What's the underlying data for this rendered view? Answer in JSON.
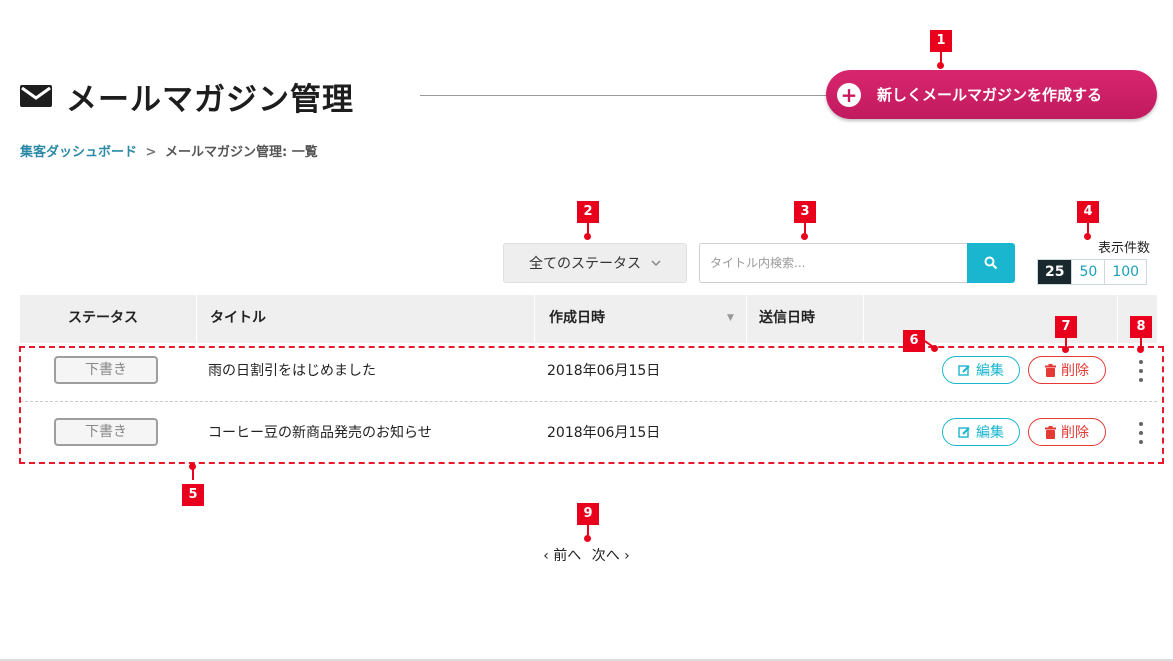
{
  "header": {
    "title": "メールマガジン管理",
    "create_button_label": "新しくメールマガジンを作成する"
  },
  "breadcrumb": {
    "parent": "集客ダッシュボード",
    "separator": ">",
    "current": "メールマガジン管理: 一覧"
  },
  "toolbar": {
    "status_filter": "全てのステータス",
    "search_placeholder": "タイトル内検索...",
    "per_page_label": "表示件数",
    "per_page_options": [
      "25",
      "50",
      "100"
    ],
    "per_page_selected": "25"
  },
  "table": {
    "columns": [
      "ステータス",
      "タイトル",
      "作成日時",
      "送信日時"
    ],
    "rows": [
      {
        "status": "下書き",
        "title": "雨の日割引をはじめました",
        "created": "2018年06月15日",
        "sent": "",
        "edit": "編集",
        "delete": "削除"
      },
      {
        "status": "下書き",
        "title": "コーヒー豆の新商品発売のお知らせ",
        "created": "2018年06月15日",
        "sent": "",
        "edit": "編集",
        "delete": "削除"
      }
    ]
  },
  "pagination": {
    "prev": "‹ 前へ",
    "next": "次へ ›"
  },
  "annotations": [
    "1",
    "2",
    "3",
    "4",
    "5",
    "6",
    "7",
    "8",
    "9"
  ],
  "colors": {
    "accent": "#c8195f",
    "cyan": "#1ab6cf",
    "danger": "#e53935",
    "marker": "#e8001c",
    "link": "#2c8aa6"
  },
  "icons": [
    "envelope-icon",
    "plus-circle-icon",
    "chevron-down-icon",
    "search-icon",
    "edit-icon",
    "trash-icon",
    "kebab-menu-icon",
    "sort-arrow-icon"
  ]
}
